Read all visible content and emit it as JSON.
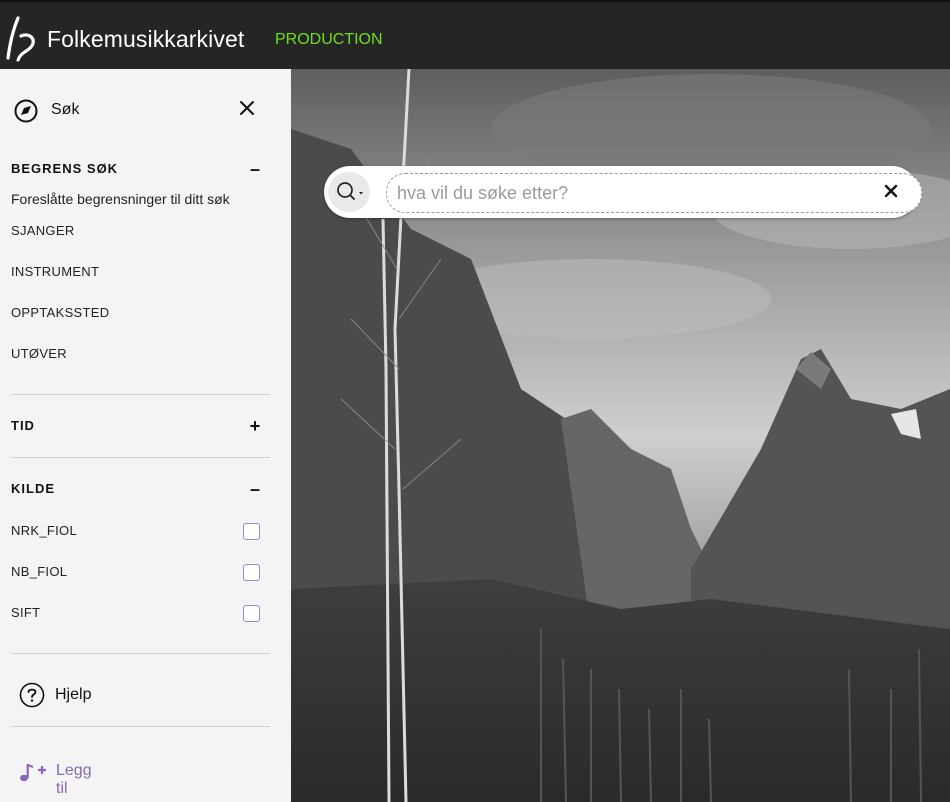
{
  "header": {
    "app_title": "Folkemusikkarkivet",
    "environment": "PRODUCTION",
    "env_color": "#6ee01a"
  },
  "sidebar": {
    "title": "Søk",
    "sections": {
      "begrens": {
        "title": "BEGRENS SØK",
        "toggle": "–",
        "hint": "Foreslåtte begrensninger til ditt søk",
        "facets": [
          "SJANGER",
          "INSTRUMENT",
          "OPPTAKSSTED",
          "UTØVER"
        ]
      },
      "tid": {
        "title": "TID",
        "toggle": "+"
      },
      "kilde": {
        "title": "KILDE",
        "toggle": "–",
        "sources": [
          "NRK_FIOL",
          "NB_FIOL",
          "SIFT"
        ]
      }
    },
    "help_label": "Hjelp",
    "add_label": "Legg til",
    "accent": "#8a66b5"
  },
  "search": {
    "placeholder": "hva vil du søke etter?"
  }
}
